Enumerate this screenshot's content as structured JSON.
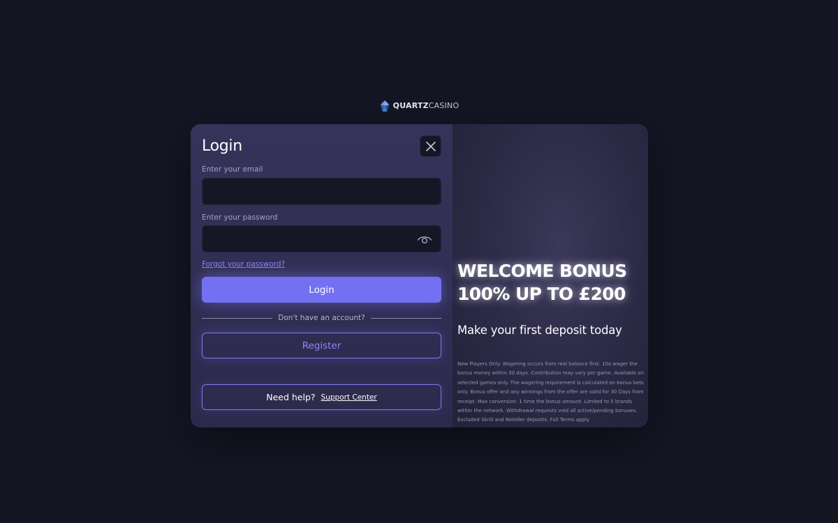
{
  "brand": {
    "name_bold": "QUARTZ",
    "name_light": "CASINO",
    "logo_icon": "quartz-crystal-icon",
    "accent_color": "#5f8fe6"
  },
  "login": {
    "title": "Login",
    "close_icon": "close-icon",
    "email_label": "Enter your email",
    "email_value": "",
    "password_label": "Enter your password",
    "password_value": "",
    "password_toggle_icon": "eye-icon",
    "forgot_password": "Forgot your password?",
    "login_button": "Login",
    "no_account": "Don't have an account?",
    "register_button": "Register",
    "help_text": "Need help?",
    "support_link": "Support Center"
  },
  "promo": {
    "headline_line1": "WELCOME BONUS",
    "headline_line2": "100% UP TO £200",
    "subheadline": "Make your first deposit today",
    "terms": "New Players Only. Wagering occurs from real balance first. 10x wager the bonus money within 30 days. Contribution may vary per game. Available on selected games only. The wagering requirement is calculated on bonus bets only. Bonus offer and any winnings from the offer are valid for 30 Days from receipt. Max conversion: 1 time the bonus amount. Limited to 5 brands within the network. Withdrawal requests void all active/pending bonuses. Excluded Skrill and Neteller deposits. Full Terms apply"
  },
  "colors": {
    "background": "#141624",
    "panel": "#312e52",
    "primary": "#7371f2",
    "input": "#161726"
  }
}
